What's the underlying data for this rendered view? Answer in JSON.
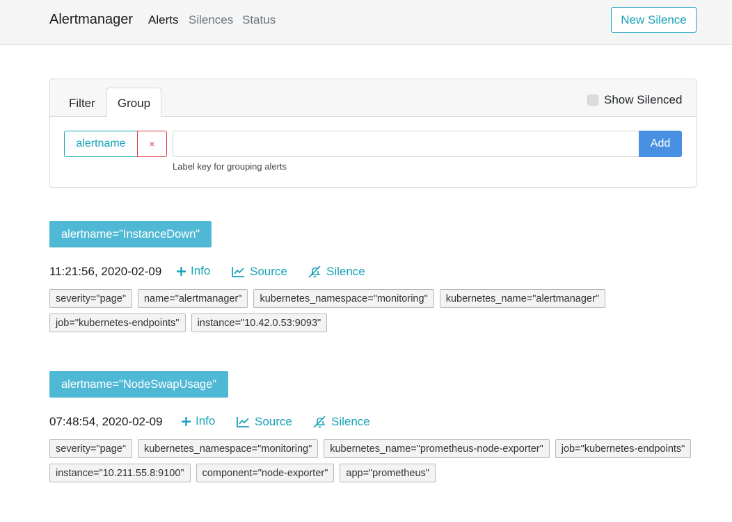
{
  "navbar": {
    "brand": "Alertmanager",
    "links": [
      "Alerts",
      "Silences",
      "Status"
    ],
    "new_silence_label": "New Silence"
  },
  "filter_card": {
    "tabs": [
      "Filter",
      "Group"
    ],
    "active_tab": "Group",
    "show_silenced_label": "Show Silenced",
    "show_silenced_checked": false,
    "group_chip": "alertname",
    "chip_remove_glyph": "×",
    "input_value": "",
    "add_label": "Add",
    "help_text": "Label key for grouping alerts"
  },
  "alert_groups": [
    {
      "header": "alertname=\"InstanceDown\"",
      "alerts": [
        {
          "time": "11:21:56, 2020-02-09",
          "actions": [
            "Info",
            "Source",
            "Silence"
          ],
          "labels": [
            "severity=\"page\"",
            "name=\"alertmanager\"",
            "kubernetes_namespace=\"monitoring\"",
            "kubernetes_name=\"alertmanager\"",
            "job=\"kubernetes-endpoints\"",
            "instance=\"10.42.0.53:9093\""
          ]
        }
      ]
    },
    {
      "header": "alertname=\"NodeSwapUsage\"",
      "alerts": [
        {
          "time": "07:48:54, 2020-02-09",
          "actions": [
            "Info",
            "Source",
            "Silence"
          ],
          "labels": [
            "severity=\"page\"",
            "kubernetes_namespace=\"monitoring\"",
            "kubernetes_name=\"prometheus-node-exporter\"",
            "job=\"kubernetes-endpoints\"",
            "instance=\"10.211.55.8:9100\"",
            "component=\"node-exporter\"",
            "app=\"prometheus\""
          ]
        }
      ]
    }
  ],
  "colors": {
    "accent": "#17a2b8",
    "group_header_bg": "#4fb8d5",
    "add_button_bg": "#4a90e2",
    "remove_red": "#dc3545"
  }
}
